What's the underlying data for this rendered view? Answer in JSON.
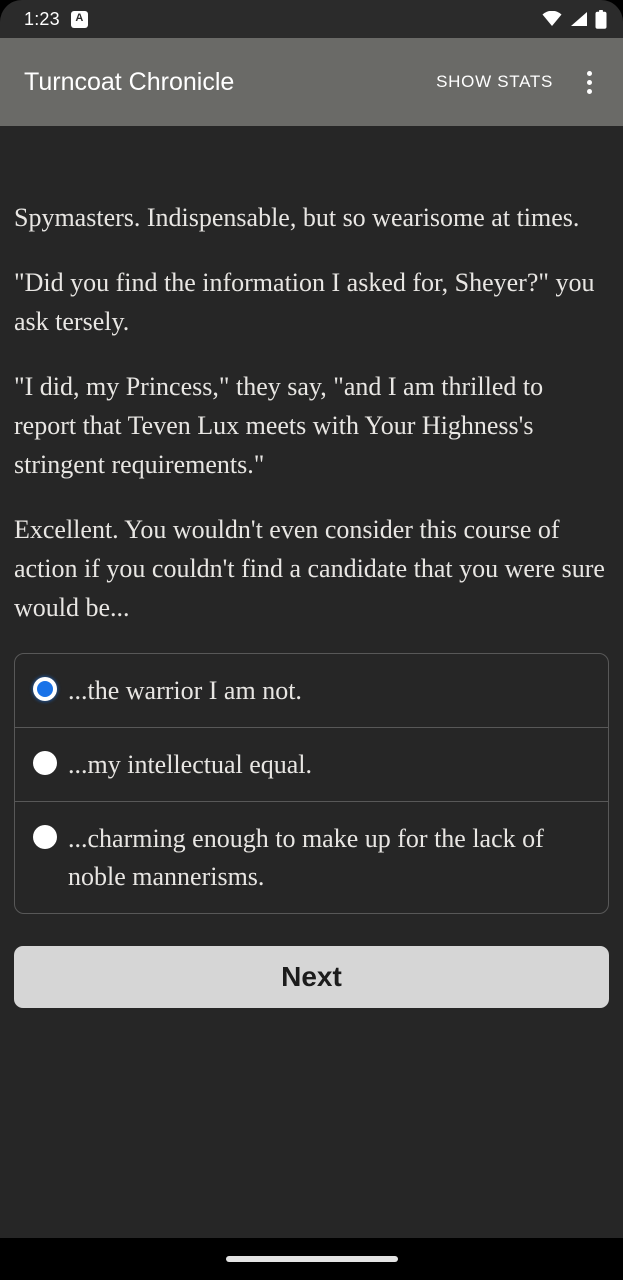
{
  "status_bar": {
    "clock": "1:23",
    "notification_badge": "A",
    "icons": [
      "wifi-icon",
      "cellular-signal-icon",
      "battery-icon"
    ]
  },
  "app_bar": {
    "title": "Turncoat Chronicle",
    "show_stats_label": "SHOW STATS",
    "overflow_menu": "more-options-icon",
    "background_color": "#6a6a67"
  },
  "story": {
    "paragraphs": [
      "Spymasters. Indispensable, but so wearisome at times.",
      "\"Did you find the information I asked for, Sheyer?\" you ask tersely.",
      "\"I did, my Princess,\" they say, \"and I am thrilled to report that Teven Lux meets with Your Highness's stringent requirements.\"",
      "Excellent. You wouldn't even consider this course of action if you couldn't find a candidate that you were sure would be..."
    ]
  },
  "choices": {
    "options": [
      {
        "label": "...the warrior I am not.",
        "selected": true
      },
      {
        "label": "...my intellectual equal.",
        "selected": false
      },
      {
        "label": "...charming enough to make up for the lack of noble mannerisms.",
        "selected": false
      }
    ],
    "selected_color": "#1a73e8"
  },
  "actions": {
    "next_label": "Next"
  },
  "theme": {
    "background": "#262626",
    "text_color": "#e8e6e3",
    "accent": "#1a73e8"
  }
}
